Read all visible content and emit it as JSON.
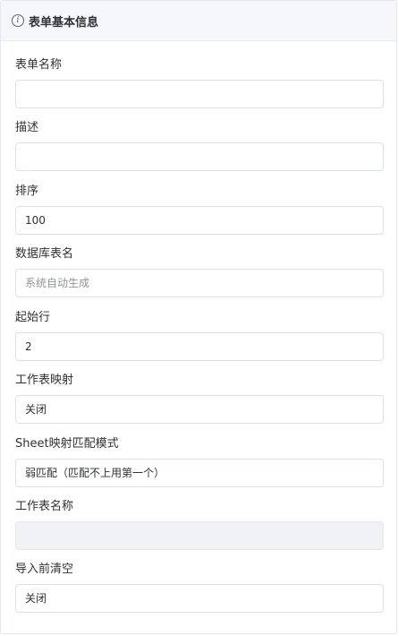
{
  "panel": {
    "title": "表单基本信息",
    "icon": "info-icon"
  },
  "fields": [
    {
      "label": "表单名称",
      "value": "",
      "placeholder": ""
    },
    {
      "label": "描述",
      "value": "",
      "placeholder": ""
    },
    {
      "label": "排序",
      "value": "100",
      "placeholder": ""
    },
    {
      "label": "数据库表名",
      "value": "",
      "placeholder": "系统自动生成"
    },
    {
      "label": "起始行",
      "value": "2",
      "placeholder": ""
    },
    {
      "label": "工作表映射",
      "value": "关闭",
      "placeholder": ""
    },
    {
      "label": "Sheet映射匹配模式",
      "value": "弱匹配（匹配不上用第一个）",
      "placeholder": ""
    },
    {
      "label": "工作表名称",
      "value": "",
      "placeholder": "",
      "disabled": true
    },
    {
      "label": "导入前清空",
      "value": "关闭",
      "placeholder": ""
    }
  ]
}
